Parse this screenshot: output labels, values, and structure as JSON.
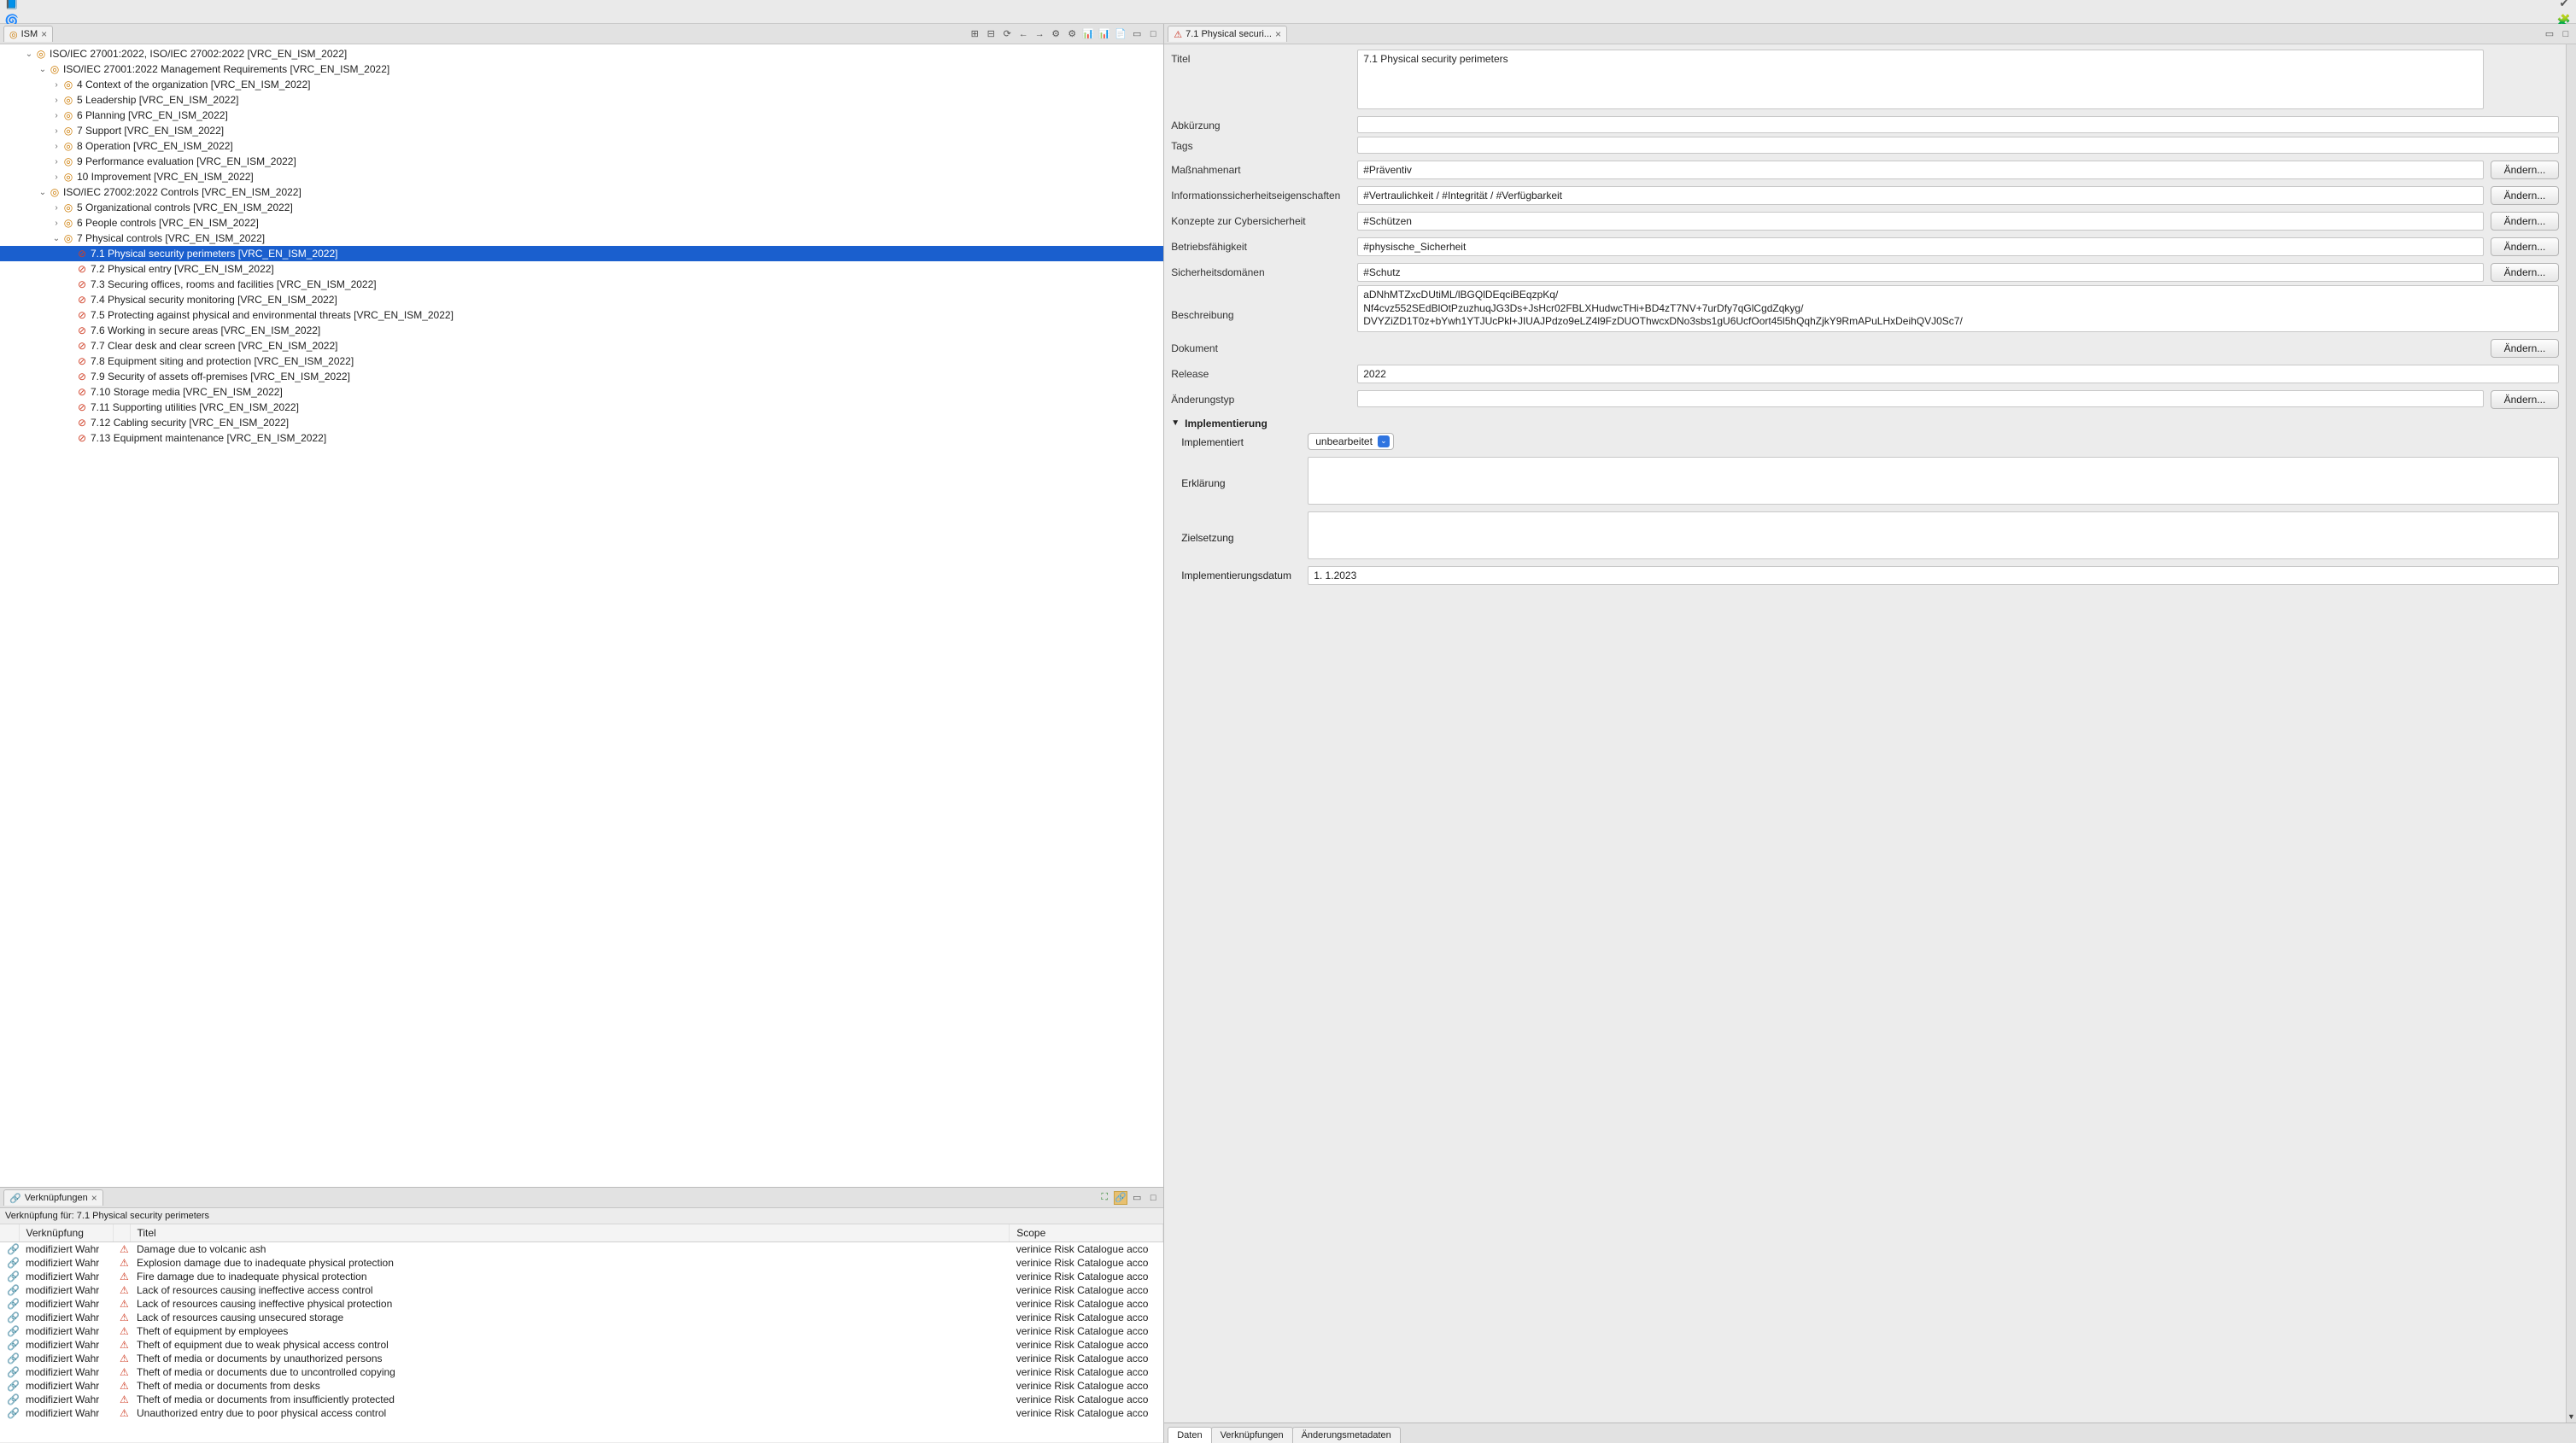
{
  "toolbar_icons": [
    "📄",
    "📑",
    "📋",
    "🖨",
    "🖨",
    "📄",
    "🔄",
    "↩",
    "↪",
    "📝",
    "📑",
    "🔗",
    "🔧",
    "✔",
    "◻",
    "📘",
    "🌀",
    "↩",
    "📚",
    "👤",
    "👥",
    "←",
    "→",
    "</>",
    " ✏ ",
    "📎",
    "🔗",
    "🅰",
    "🔎",
    "🔍",
    "↩",
    "↪"
  ],
  "toolbar_right": [
    "⊞",
    "✔",
    "🧩",
    "🧩"
  ],
  "ism_tab": "ISM",
  "tree": [
    {
      "ind": 0,
      "open": true,
      "ico": "🧩",
      "t": "ISO/IEC 27001:2022, ISO/IEC 27002:2022 [VRC_EN_ISM_2022]"
    },
    {
      "ind": 1,
      "open": true,
      "ico": "🧩",
      "t": "ISO/IEC 27001:2022 Management Requirements [VRC_EN_ISM_2022]"
    },
    {
      "ind": 2,
      "open": false,
      "ico": "🧩",
      "t": "4 Context of the organization [VRC_EN_ISM_2022]"
    },
    {
      "ind": 2,
      "open": false,
      "ico": "🧩",
      "t": "5 Leadership [VRC_EN_ISM_2022]"
    },
    {
      "ind": 2,
      "open": false,
      "ico": "🧩",
      "t": "6 Planning [VRC_EN_ISM_2022]"
    },
    {
      "ind": 2,
      "open": false,
      "ico": "🧩",
      "t": "7 Support [VRC_EN_ISM_2022]"
    },
    {
      "ind": 2,
      "open": false,
      "ico": "🧩",
      "t": "8 Operation [VRC_EN_ISM_2022]"
    },
    {
      "ind": 2,
      "open": false,
      "ico": "🧩",
      "t": "9 Performance evaluation [VRC_EN_ISM_2022]"
    },
    {
      "ind": 2,
      "open": false,
      "ico": "🧩",
      "t": "10 Improvement [VRC_EN_ISM_2022]"
    },
    {
      "ind": 1,
      "open": true,
      "ico": "🧩",
      "t": "ISO/IEC 27002:2022 Controls [VRC_EN_ISM_2022]"
    },
    {
      "ind": 2,
      "open": false,
      "ico": "🧩",
      "t": "5 Organizational controls  [VRC_EN_ISM_2022]"
    },
    {
      "ind": 2,
      "open": false,
      "ico": "🧩",
      "t": "6 People controls  [VRC_EN_ISM_2022]"
    },
    {
      "ind": 2,
      "open": true,
      "ico": "🧩",
      "t": "7 Physical controls  [VRC_EN_ISM_2022]"
    },
    {
      "ind": 3,
      "sel": true,
      "ico": "⚠",
      "t": "7.1 Physical security perimeters [VRC_EN_ISM_2022]"
    },
    {
      "ind": 3,
      "ico": "⚠",
      "t": "7.2 Physical entry [VRC_EN_ISM_2022]"
    },
    {
      "ind": 3,
      "ico": "⚠",
      "t": "7.3 Securing offices, rooms and facilities [VRC_EN_ISM_2022]"
    },
    {
      "ind": 3,
      "ico": "⚠",
      "t": "7.4 Physical security monitoring [VRC_EN_ISM_2022]"
    },
    {
      "ind": 3,
      "ico": "⚠",
      "t": "7.5 Protecting against physical and environmental threats [VRC_EN_ISM_2022]"
    },
    {
      "ind": 3,
      "ico": "⚠",
      "t": "7.6 Working in secure areas [VRC_EN_ISM_2022]"
    },
    {
      "ind": 3,
      "ico": "⚠",
      "t": "7.7 Clear desk and clear screen [VRC_EN_ISM_2022]"
    },
    {
      "ind": 3,
      "ico": "⚠",
      "t": "7.8 Equipment siting and protection [VRC_EN_ISM_2022]"
    },
    {
      "ind": 3,
      "ico": "⚠",
      "t": "7.9 Security of assets off-premises [VRC_EN_ISM_2022]"
    },
    {
      "ind": 3,
      "ico": "⚠",
      "t": "7.10 Storage media [VRC_EN_ISM_2022]"
    },
    {
      "ind": 3,
      "ico": "⚠",
      "t": "7.11 Supporting utilities [VRC_EN_ISM_2022]"
    },
    {
      "ind": 3,
      "ico": "⚠",
      "t": "7.12 Cabling security [VRC_EN_ISM_2022]"
    },
    {
      "ind": 3,
      "ico": "⚠",
      "t": "7.13 Equipment maintenance [VRC_EN_ISM_2022]"
    }
  ],
  "links": {
    "title": "Verknüpfungen",
    "subtitle": "Verknüpfung für: 7.1 Physical security perimeters",
    "cols": [
      "Verknüpfung",
      "Titel",
      "Scope"
    ],
    "rows": [
      {
        "r": "modifiziert Wahr",
        "t": "Damage due to volcanic ash",
        "s": "verinice Risk Catalogue acco"
      },
      {
        "r": "modifiziert Wahr",
        "t": "Explosion damage due to inadequate physical protection",
        "s": "verinice Risk Catalogue acco"
      },
      {
        "r": "modifiziert Wahr",
        "t": "Fire damage due to inadequate physical protection",
        "s": "verinice Risk Catalogue acco"
      },
      {
        "r": "modifiziert Wahr",
        "t": "Lack of resources causing ineffective access control",
        "s": "verinice Risk Catalogue acco"
      },
      {
        "r": "modifiziert Wahr",
        "t": "Lack of resources causing ineffective physical protection",
        "s": "verinice Risk Catalogue acco"
      },
      {
        "r": "modifiziert Wahr",
        "t": "Lack of resources causing unsecured storage",
        "s": "verinice Risk Catalogue acco"
      },
      {
        "r": "modifiziert Wahr",
        "t": "Theft of equipment by employees",
        "s": "verinice Risk Catalogue acco"
      },
      {
        "r": "modifiziert Wahr",
        "t": "Theft of equipment due to weak physical access control",
        "s": "verinice Risk Catalogue acco"
      },
      {
        "r": "modifiziert Wahr",
        "t": "Theft of media or documents by unauthorized persons",
        "s": "verinice Risk Catalogue acco"
      },
      {
        "r": "modifiziert Wahr",
        "t": "Theft of media or documents due to uncontrolled copying",
        "s": "verinice Risk Catalogue acco"
      },
      {
        "r": "modifiziert Wahr",
        "t": "Theft of media or documents from desks",
        "s": "verinice Risk Catalogue acco"
      },
      {
        "r": "modifiziert Wahr",
        "t": "Theft of media or documents from insufficiently protected",
        "s": "verinice Risk Catalogue acco"
      },
      {
        "r": "modifiziert Wahr",
        "t": "Unauthorized entry due to poor physical access control",
        "s": "verinice Risk Catalogue acco"
      }
    ]
  },
  "editor": {
    "tab": "7.1 Physical securi...",
    "title_label": "Titel",
    "title_value": "7.1 Physical security perimeters",
    "abbr_label": "Abkürzung",
    "abbr_value": "",
    "tags_label": "Tags",
    "tags_value": "",
    "measure_label": "Maßnahmenart",
    "measure_value": "#Präventiv",
    "infosec_label": "Informationssicherheitseigenschaften",
    "infosec_value": "#Vertraulichkeit / #Integrität / #Verfügbarkeit",
    "cyber_label": "Konzepte zur Cybersicherheit",
    "cyber_value": "#Schützen",
    "opcap_label": "Betriebsfähigkeit",
    "opcap_value": "#physische_Sicherheit",
    "secdom_label": "Sicherheitsdomänen",
    "secdom_value": "#Schutz",
    "desc_label": "Beschreibung",
    "desc_value": "aDNhMTZxcDUtiML/lBGQlDEqciBEqzpKq/\nNf4cvz552SEdBlOtPzuzhuqJG3Ds+JsHcr02FBLXHudwcTHi+BD4zT7NV+7urDfy7qGlCgdZqkyg/\nDVYZiZD1T0z+bYwh1YTJUcPkl+JIUAJPdzo9eLZ4l9FzDUOThwcxDNo3sbs1gU6UcfOort45l5hQqhZjkY9RmAPuLHxDeihQVJ0Sc7/",
    "doc_label": "Dokument",
    "release_label": "Release",
    "release_value": "2022",
    "changetype_label": "Änderungstyp",
    "changetype_value": "",
    "change_btn": "Ändern...",
    "impl_section": "Implementierung",
    "impl_label": "Implementiert",
    "impl_value": "unbearbeitet",
    "expl_label": "Erklärung",
    "goal_label": "Zielsetzung",
    "impldate_label": "Implementierungsdatum",
    "impldate_value": "1.  1.2023"
  },
  "bottom_tabs": [
    "Daten",
    "Verknüpfungen",
    "Änderungsmetadaten"
  ]
}
